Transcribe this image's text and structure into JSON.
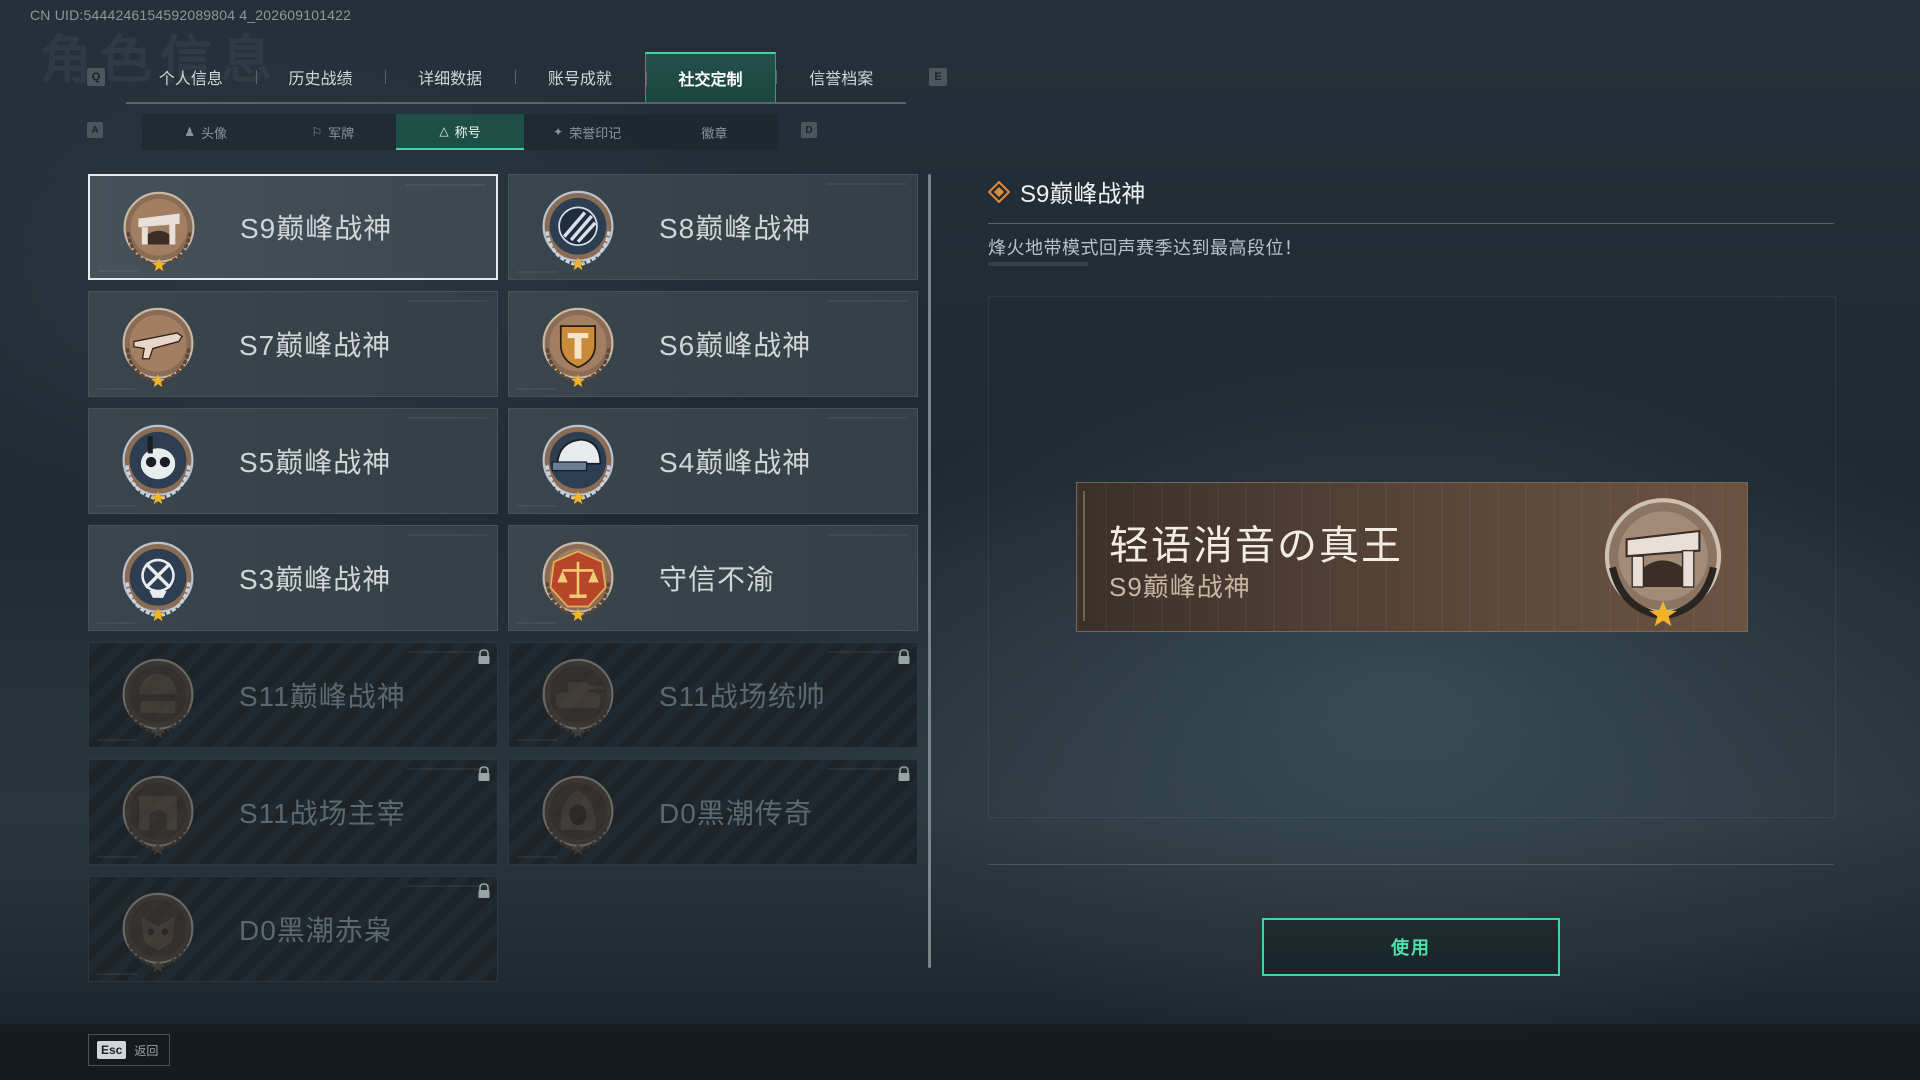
{
  "uid": "CN UID:5444246154592089804 4_202609101422",
  "bg_title": "角色信息",
  "keys": {
    "prev_tab": "Q",
    "next_tab": "E",
    "prev_sub": "A",
    "next_sub": "D"
  },
  "tabs": [
    {
      "label": "个人信息"
    },
    {
      "label": "历史战绩"
    },
    {
      "label": "详细数据"
    },
    {
      "label": "账号成就"
    },
    {
      "label": "社交定制",
      "active": true
    },
    {
      "label": "信誉档案"
    }
  ],
  "subtabs": [
    {
      "label": "头像",
      "icon": "person-icon"
    },
    {
      "label": "军牌",
      "icon": "tag-icon"
    },
    {
      "label": "称号",
      "icon": "triangle-icon",
      "active": true
    },
    {
      "label": "荣誉印记",
      "icon": "emblem-icon"
    },
    {
      "label": "徽章",
      "icon": ""
    }
  ],
  "titles": [
    {
      "label": "S9巅峰战神",
      "medal": "monument-medal",
      "locked": false,
      "selected": true
    },
    {
      "label": "S8巅峰战神",
      "medal": "slash-medal",
      "locked": false
    },
    {
      "label": "S7巅峰战神",
      "medal": "rifle-medal",
      "locked": false
    },
    {
      "label": "S6巅峰战神",
      "medal": "shield-t-medal",
      "locked": false
    },
    {
      "label": "S5巅峰战神",
      "medal": "skull-diver-medal",
      "locked": false
    },
    {
      "label": "S4巅峰战神",
      "medal": "helmet-medal",
      "locked": false
    },
    {
      "label": "S3巅峰战神",
      "medal": "compass-medal",
      "locked": false
    },
    {
      "label": "守信不渝",
      "medal": "scales-medal",
      "locked": false
    },
    {
      "label": "S11巅峰战神",
      "medal": "soldier-medal",
      "locked": true
    },
    {
      "label": "S11战场统帅",
      "medal": "tank-medal",
      "locked": true
    },
    {
      "label": "S11战场主宰",
      "medal": "arch-medal",
      "locked": true
    },
    {
      "label": "D0黑潮传奇",
      "medal": "hood-medal",
      "locked": true
    },
    {
      "label": "D0黑潮赤枭",
      "medal": "owl-mask-medal",
      "locked": true
    }
  ],
  "detail": {
    "title": "S9巅峰战神",
    "description": "烽火地带模式回声赛季达到最高段位！",
    "banner_name": "轻语消音の真王",
    "banner_title": "S9巅峰战神",
    "use_button": "使用"
  },
  "footer": {
    "esc_key": "Esc",
    "esc_label": "返回"
  },
  "colors": {
    "accent": "#3fd6a0",
    "medal_bronze": "#b08a6a",
    "banner_brown": "#5a4638",
    "selected_border": "#e6eaec"
  }
}
